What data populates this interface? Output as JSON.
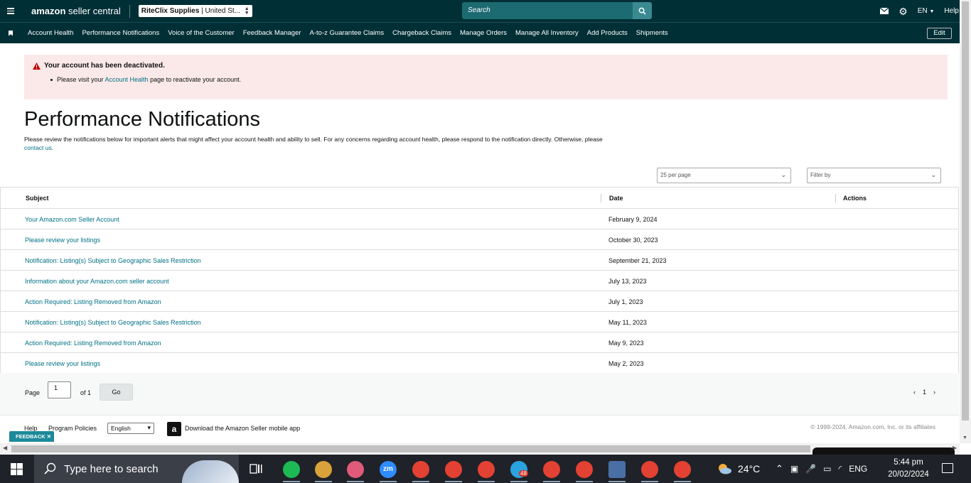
{
  "topbar": {
    "logo_bold": "amazon",
    "logo_rest": " seller central",
    "account_name": "RiteClix Supplies",
    "account_region": " | United St...",
    "search_placeholder": "Search",
    "language": "EN",
    "help": "Help"
  },
  "nav": {
    "items": [
      "Account Health",
      "Performance Notifications",
      "Voice of the Customer",
      "Feedback Manager",
      "A-to-z Guarantee Claims",
      "Chargeback Claims",
      "Manage Orders",
      "Manage All Inventory",
      "Add Products",
      "Shipments"
    ],
    "edit": "Edit"
  },
  "alert": {
    "title": "Your account has been deactivated.",
    "body_prefix": "Please visit your ",
    "body_link": "Account Health",
    "body_suffix": " page to reactivate your account."
  },
  "page": {
    "title": "Performance Notifications",
    "intro_text": "Please review the notifications below for important alerts that might affect your account health and ability to sell. For any concerns regarding account health, please respond to the notification directly. Otherwise, please ",
    "intro_link": "contact us",
    "intro_end": "."
  },
  "controls": {
    "per_page": "25 per page",
    "filter_placeholder": "Filter by"
  },
  "table": {
    "headers": {
      "subject": "Subject",
      "date": "Date",
      "actions": "Actions"
    },
    "rows": [
      {
        "subject": "Your Amazon.com Seller Account",
        "date": "February 9, 2024"
      },
      {
        "subject": "Please review your listings",
        "date": "October 30, 2023"
      },
      {
        "subject": "Notification: Listing(s) Subject to Geographic Sales Restriction",
        "date": "September 21, 2023"
      },
      {
        "subject": "Information about your Amazon.com seller account",
        "date": "July 13, 2023"
      },
      {
        "subject": "Action Required: Listing Removed from Amazon",
        "date": "July 1, 2023"
      },
      {
        "subject": "Notification: Listing(s) Subject to Geographic Sales Restriction",
        "date": "May 11, 2023"
      },
      {
        "subject": "Action Required: Listing Removed from Amazon",
        "date": "May 9, 2023"
      },
      {
        "subject": "Please review your listings",
        "date": "May 2, 2023"
      }
    ]
  },
  "pager": {
    "page_label": "Page",
    "page_value": "1",
    "of_label": "of 1",
    "go": "Go",
    "current": "1"
  },
  "footer": {
    "help": "Help",
    "policies": "Program Policies",
    "language": "English",
    "app_text": "Download the Amazon Seller mobile app",
    "copyright": "© 1999-2024, Amazon.com, Inc. or its affiliates",
    "feedback": "FEEDBACK"
  },
  "taskbar": {
    "search_text": "Type here to search",
    "weather": "24°C",
    "lang": "ENG",
    "time": "5:44 pm",
    "date": "20/02/2024",
    "telegram_badge": "48",
    "zoom_label": "zm",
    "apps": [
      {
        "name": "spotify",
        "color": "#1db954"
      },
      {
        "name": "game",
        "color": "#d9a23a"
      },
      {
        "name": "snipping",
        "color": "#e05a7a"
      },
      {
        "name": "zoom",
        "color": "#2d8cff"
      },
      {
        "name": "chrome-m",
        "color": "#e34133"
      },
      {
        "name": "chrome-a",
        "color": "#e34133"
      },
      {
        "name": "chrome-l",
        "color": "#e34133"
      },
      {
        "name": "telegram",
        "color": "#2aa3e0"
      },
      {
        "name": "chrome-m2",
        "color": "#e34133"
      },
      {
        "name": "chrome-m3",
        "color": "#e34133"
      },
      {
        "name": "calculator",
        "color": "#4a6fa5"
      },
      {
        "name": "chrome-r",
        "color": "#e34133"
      },
      {
        "name": "chrome-s",
        "color": "#e34133"
      }
    ]
  }
}
